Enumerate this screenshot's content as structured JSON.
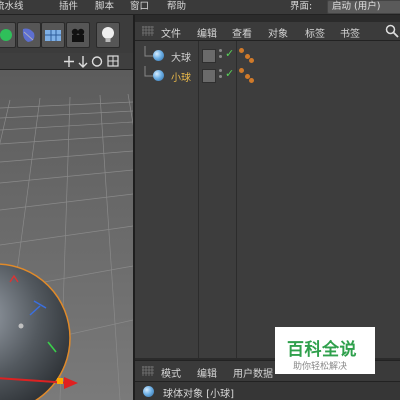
{
  "menubar": {
    "items": [
      "流水线",
      "插件",
      "脚本",
      "窗口",
      "帮助"
    ],
    "layout_label": "界面:",
    "layout_value": "启动 (用户)"
  },
  "object_manager": {
    "menu": [
      "文件",
      "编辑",
      "查看",
      "对象",
      "标签",
      "书签"
    ],
    "objects": [
      {
        "name": "大球",
        "selected": false
      },
      {
        "name": "小球",
        "selected": true
      }
    ]
  },
  "attribute_manager": {
    "menu": [
      "模式",
      "编辑",
      "用户数据"
    ],
    "title": "球体对象 [小球]"
  },
  "watermark": {
    "main": "百科全说",
    "sub": "助你轻松解决"
  },
  "colors": {
    "selected_text": "#e8b84a",
    "normal_text": "#cfcfcf",
    "check": "#58d058",
    "tag": "#d07a2a",
    "watermark_green": "#2fa04c"
  }
}
